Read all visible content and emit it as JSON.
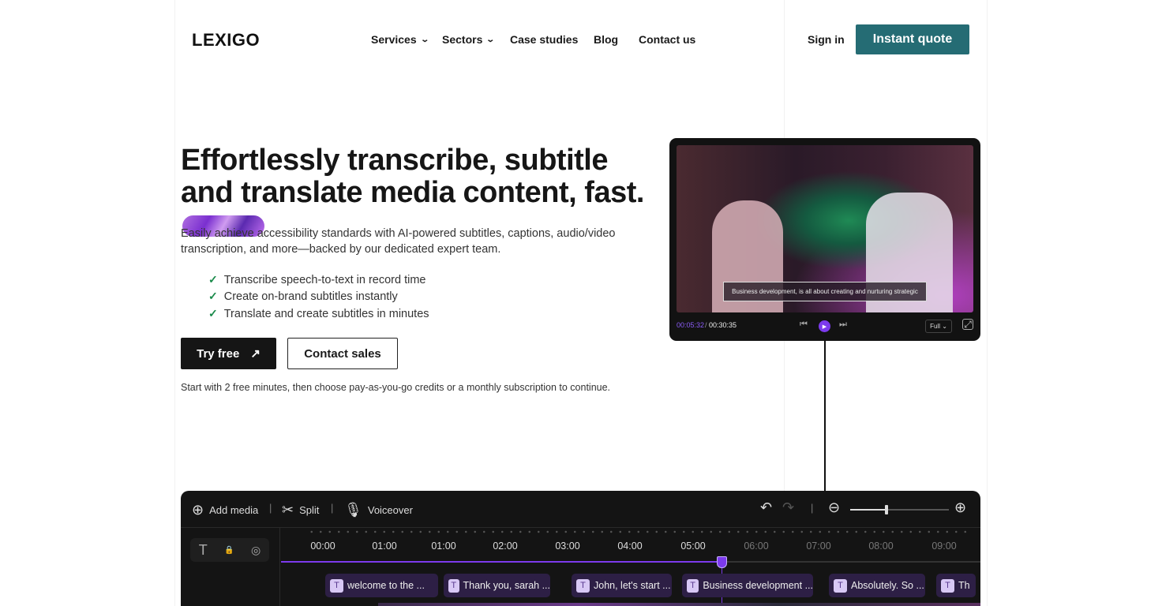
{
  "header": {
    "logo": "LEXIGO",
    "nav": [
      {
        "label": "Services",
        "dropdown": true
      },
      {
        "label": "Sectors",
        "dropdown": true
      },
      {
        "label": "Case studies"
      },
      {
        "label": "Blog"
      },
      {
        "label": "Contact us"
      }
    ],
    "sign_in": "Sign in",
    "cta": "Instant quote",
    "cta_color": "#256c74"
  },
  "hero": {
    "title": "Effortlessly transcribe, subtitle and translate media content, fast.",
    "lead": "Easily achieve accessibility standards with AI-powered subtitles, captions, audio/video transcription, and more—backed by our dedicated expert team.",
    "features": [
      "Transcribe speech-to-text in record time",
      "Create on-brand subtitles instantly",
      "Translate and create subtitles in minutes"
    ],
    "try_free": "Try free",
    "contact_sales": "Contact sales",
    "note": "Start with 2 free minutes, then choose pay-as-you-go credits or a monthly subscription to continue."
  },
  "player": {
    "caption": "Business development, is all about creating and nurturing strategic",
    "current": "00:05:32",
    "separator": "/",
    "total": "00:30:35",
    "quality": "Full",
    "accent": "#7c3aed"
  },
  "editor": {
    "toolbar": {
      "add_media": "Add media",
      "split": "Split",
      "voiceover": "Voiceover"
    },
    "zoom_level": 0.35,
    "progress": 0.55,
    "ticks": [
      "00:00",
      "01:00",
      "01:00",
      "02:00",
      "03:00",
      "04:00",
      "05:00",
      "06:00",
      "07:00",
      "08:00",
      "09:00"
    ],
    "clips": [
      "welcome to the ...",
      "Thank you, sarah ...",
      "John, let's start ...",
      "Business development ...",
      "Absolutely. So ...",
      "Th"
    ]
  }
}
